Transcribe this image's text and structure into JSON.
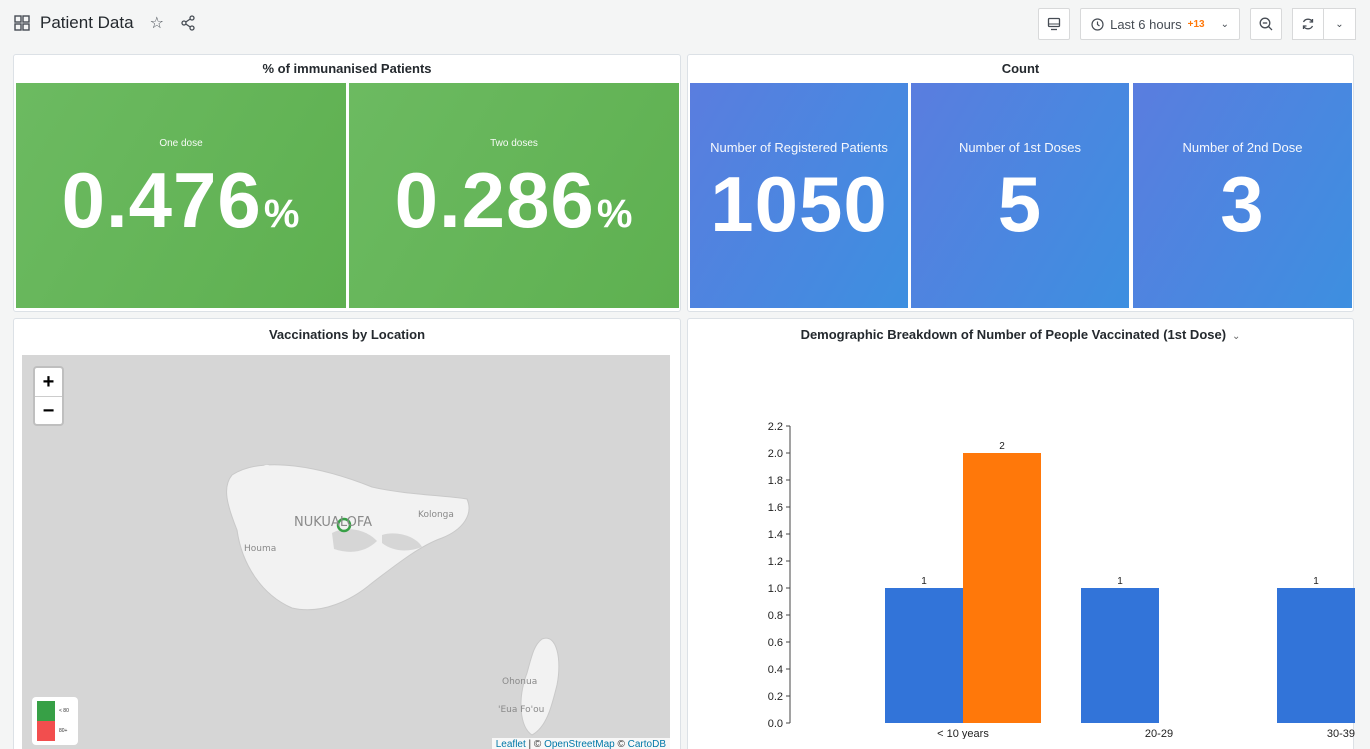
{
  "header": {
    "title": "Patient Data",
    "time_range": "Last 6 hours",
    "time_offset": "+13"
  },
  "panels": {
    "immunised": {
      "title": "% of immunanised Patients",
      "stats": [
        {
          "label": "One dose",
          "value": "0.476",
          "unit": "%"
        },
        {
          "label": "Two doses",
          "value": "0.286",
          "unit": "%"
        }
      ]
    },
    "count": {
      "title": "Count",
      "stats": [
        {
          "label": "Number of Registered Patients",
          "value": "1050"
        },
        {
          "label": "Number of 1st Doses",
          "value": "5"
        },
        {
          "label": "Number of 2nd Dose",
          "value": "3"
        }
      ]
    },
    "map": {
      "title": "Vaccinations by Location",
      "zoom_in": "+",
      "zoom_out": "−",
      "labels": {
        "city": "NUKUALOFA",
        "kolonga": "Kolonga",
        "houma": "Houma",
        "ohonua": "Ohonua",
        "eua": "'Eua Fo'ou"
      },
      "legend": [
        {
          "label": "< 80",
          "color": "#37a046"
        },
        {
          "label": "80+",
          "color": "#f24e4e"
        }
      ],
      "attribution": {
        "leaflet": "Leaflet",
        "sep": " | © ",
        "osm": "OpenStreetMap",
        "sep2": " © ",
        "carto": "CartoDB"
      }
    },
    "demographic": {
      "title": "Demographic Breakdown of Number of People Vaccinated (1st Dose)"
    }
  },
  "colors": {
    "green": "#5eb050",
    "blue": "#3274d9",
    "orange": "#ff780a",
    "marker": "#37a046"
  },
  "icons": [
    "apps-icon",
    "star-icon",
    "share-icon",
    "tv-icon",
    "clock-icon",
    "chevron-down-icon",
    "zoom-out-icon",
    "refresh-icon"
  ],
  "chart_data": {
    "type": "bar",
    "categories": [
      "< 10 years",
      "20-29",
      "30-39"
    ],
    "series_bars": [
      {
        "category": "< 10 years",
        "value": 1,
        "color": "#3274d9"
      },
      {
        "category": "< 10 years",
        "value": 2,
        "color": "#ff780a"
      },
      {
        "category": "20-29",
        "value": 1,
        "color": "#3274d9"
      },
      {
        "category": "30-39",
        "value": 1,
        "color": "#3274d9"
      }
    ],
    "ylim": [
      0,
      2.2
    ],
    "yticks": [
      "0.0",
      "0.2",
      "0.4",
      "0.6",
      "0.8",
      "1.0",
      "1.2",
      "1.4",
      "1.6",
      "1.8",
      "2.0",
      "2.2"
    ],
    "data_labels": [
      "1",
      "2",
      "1",
      "1"
    ]
  }
}
